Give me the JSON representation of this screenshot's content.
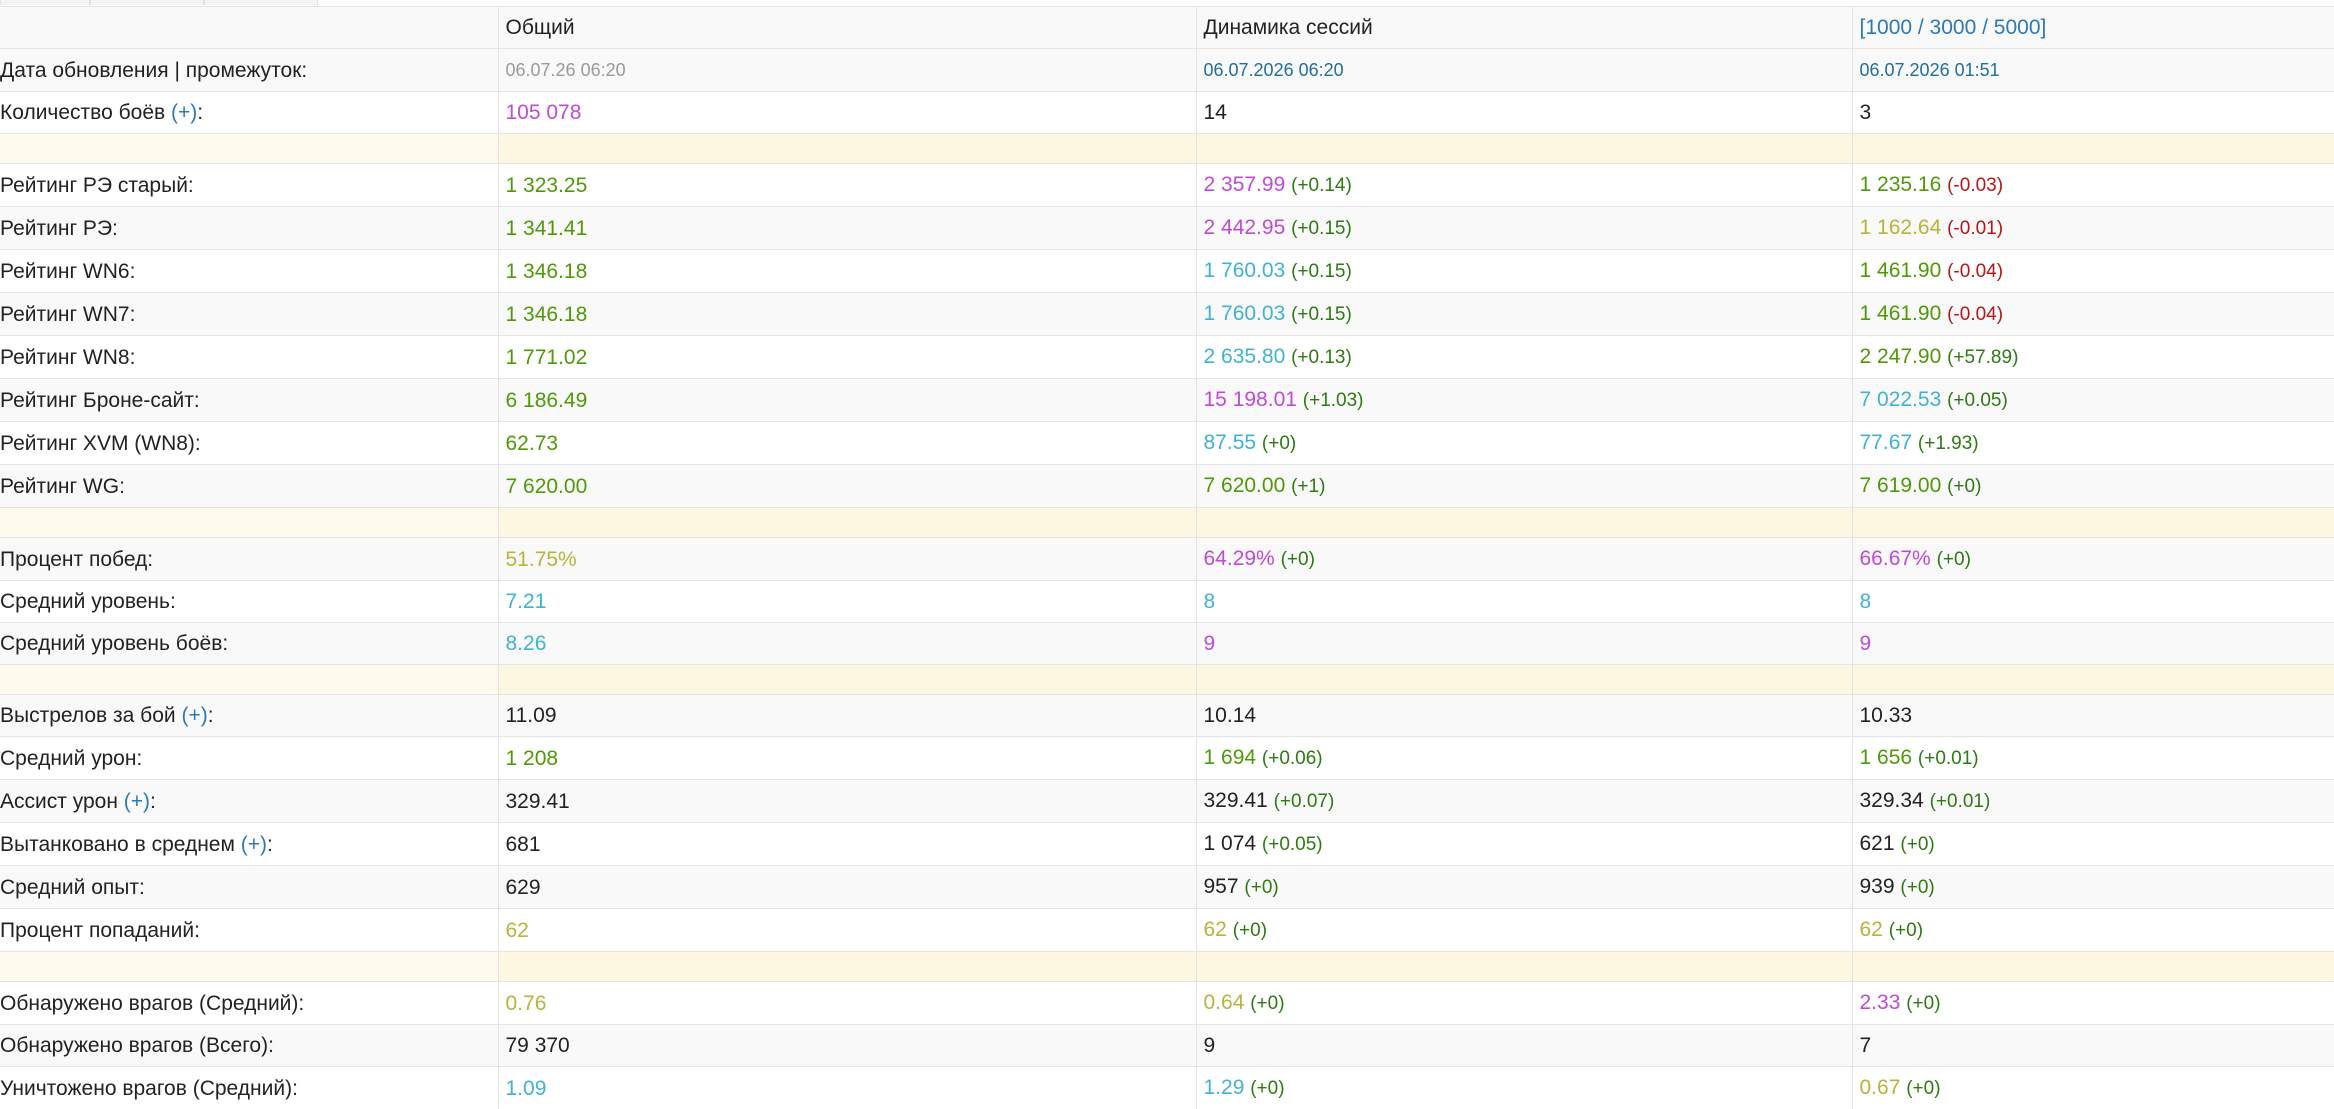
{
  "header": {
    "col_total": "Общий",
    "col_session": "Динамика сессий",
    "col_range": "[1000 / 3000 / 5000]"
  },
  "meta": {
    "update_label": "Дата обновления | промежуток:",
    "total_date": "06.07.26 06:20",
    "session_date": "06.07.2026 06:20",
    "range_date": "06.07.2026 01:51",
    "battles_label": "Количество боёв",
    "battles_plus": "(+)",
    "battles_total": "105 078",
    "battles_session": "14",
    "battles_range": "3"
  },
  "ratings": [
    {
      "label": "Рейтинг РЭ старый:",
      "total": "1 323.25",
      "session": "2 357.99",
      "session_delta": "(+0.14)",
      "range": "1 235.16",
      "range_delta": "(-0.03)"
    },
    {
      "label": "Рейтинг РЭ:",
      "total": "1 341.41",
      "session": "2 442.95",
      "session_delta": "(+0.15)",
      "range": "1 162.64",
      "range_delta": "(-0.01)"
    },
    {
      "label": "Рейтинг WN6:",
      "total": "1 346.18",
      "session": "1 760.03",
      "session_delta": "(+0.15)",
      "range": "1 461.90",
      "range_delta": "(-0.04)"
    },
    {
      "label": "Рейтинг WN7:",
      "total": "1 346.18",
      "session": "1 760.03",
      "session_delta": "(+0.15)",
      "range": "1 461.90",
      "range_delta": "(-0.04)"
    },
    {
      "label": "Рейтинг WN8:",
      "total": "1 771.02",
      "session": "2 635.80",
      "session_delta": "(+0.13)",
      "range": "2 247.90",
      "range_delta": "(+57.89)"
    },
    {
      "label": "Рейтинг Броне-сайт:",
      "total": "6 186.49",
      "session": "15 198.01",
      "session_delta": "(+1.03)",
      "range": "7 022.53",
      "range_delta": "(+0.05)"
    },
    {
      "label": "Рейтинг XVM (WN8):",
      "total": "62.73",
      "session": "87.55",
      "session_delta": "(+0)",
      "range": "77.67",
      "range_delta": "(+1.93)"
    },
    {
      "label": "Рейтинг WG:",
      "total": "7 620.00",
      "session": "7 620.00",
      "session_delta": "(+1)",
      "range": "7 619.00",
      "range_delta": "(+0)"
    }
  ],
  "general": [
    {
      "label": "Процент побед:",
      "total": "51.75%",
      "session": "64.29%",
      "session_delta": "(+0)",
      "range": "66.67%",
      "range_delta": "(+0)"
    },
    {
      "label": "Средний уровень:",
      "total": "7.21",
      "session": "8",
      "range": "8"
    },
    {
      "label": "Средний уровень боёв:",
      "total": "8.26",
      "session": "9",
      "range": "9"
    }
  ],
  "combat": {
    "shots": {
      "label": "Выстрелов за бой",
      "plus": "(+)",
      "total": "11.09",
      "session": "10.14",
      "range": "10.33"
    },
    "damage": {
      "label": "Средний урон:",
      "total": "1 208",
      "session": "1 694",
      "session_delta": "(+0.06)",
      "range": "1 656",
      "range_delta": "(+0.01)"
    },
    "assist": {
      "label": "Ассист урон",
      "plus": "(+)",
      "total": "329.41",
      "session": "329.41",
      "session_delta": "(+0.07)",
      "range": "329.34",
      "range_delta": "(+0.01)"
    },
    "blocked": {
      "label": "Вытанковано в среднем",
      "plus": "(+)",
      "total": "681",
      "session": "1 074",
      "session_delta": "(+0.05)",
      "range": "621",
      "range_delta": "(+0)"
    },
    "xp": {
      "label": "Средний опыт:",
      "total": "629",
      "session": "957",
      "session_delta": "(+0)",
      "range": "939",
      "range_delta": "(+0)"
    },
    "hit": {
      "label": "Процент попаданий:",
      "total": "62",
      "session": "62",
      "session_delta": "(+0)",
      "range": "62",
      "range_delta": "(+0)"
    }
  },
  "enemies": {
    "spotted_avg": {
      "label": "Обнаружено врагов (Средний):",
      "total": "0.76",
      "session": "0.64",
      "session_delta": "(+0)",
      "range": "2.33",
      "range_delta": "(+0)"
    },
    "spotted_total": {
      "label": "Обнаружено врагов (Всего):",
      "total": "79 370",
      "session": "9",
      "range": "7"
    },
    "destroyed_avg": {
      "label": "Уничтожено врагов (Средний):",
      "total": "1.09",
      "session": "1.29",
      "session_delta": "(+0)",
      "range": "0.67",
      "range_delta": "(+0)"
    }
  },
  "colors": {
    "purple": "#c04ad6",
    "green": "#4e9a06",
    "teal": "#3fb3d1",
    "olive": "#b7b43a",
    "delta_positive": "#2c7a12",
    "delta_negative": "#b51616",
    "link": "#2a7ab8",
    "separator": "#fdf6e1"
  }
}
